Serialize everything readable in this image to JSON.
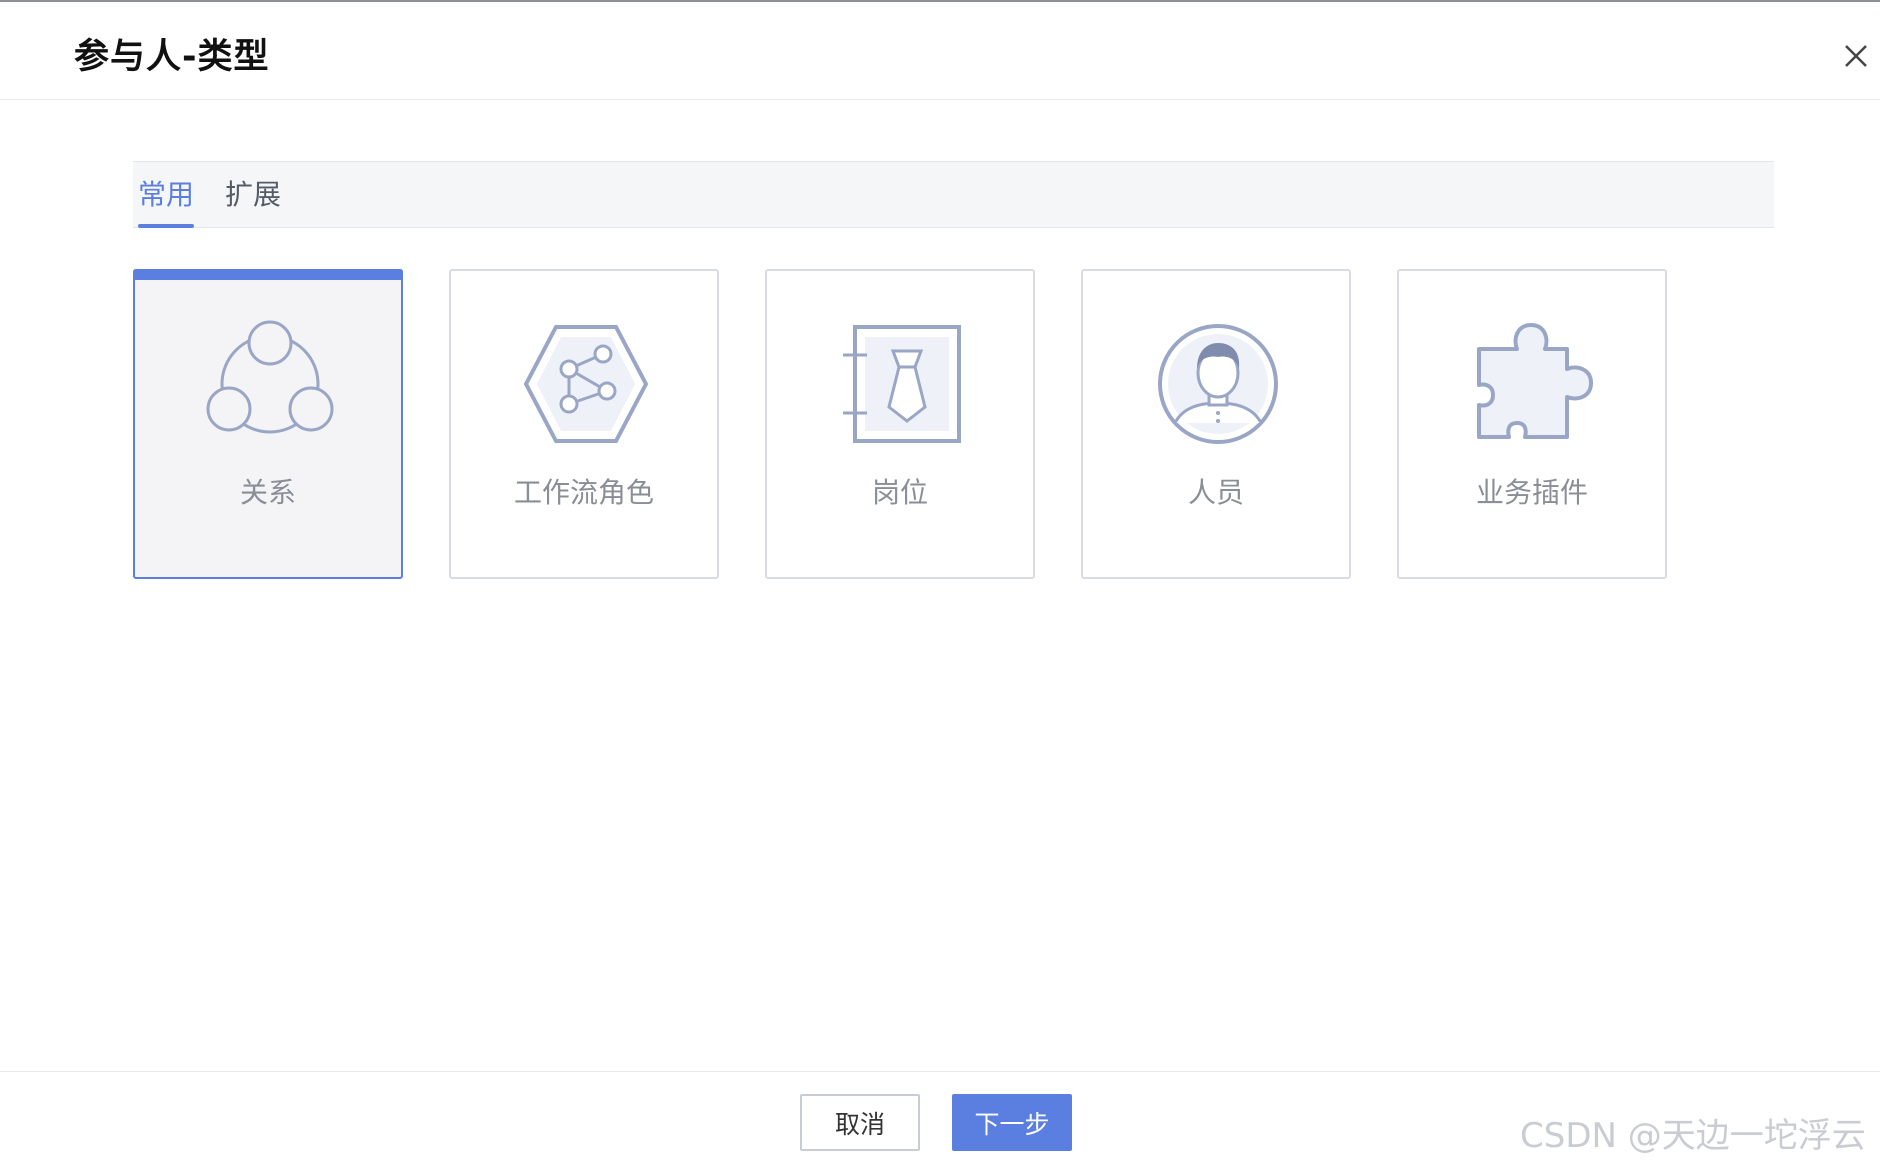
{
  "dialog": {
    "title": "参与人-类型"
  },
  "tabs": [
    {
      "label": "常用",
      "active": true
    },
    {
      "label": "扩展",
      "active": false
    }
  ],
  "cards": [
    {
      "label": "关系",
      "icon": "relationship-icon",
      "selected": true
    },
    {
      "label": "工作流角色",
      "icon": "workflow-role-icon",
      "selected": false
    },
    {
      "label": "岗位",
      "icon": "position-icon",
      "selected": false
    },
    {
      "label": "人员",
      "icon": "person-icon",
      "selected": false
    },
    {
      "label": "业务插件",
      "icon": "puzzle-plugin-icon",
      "selected": false
    }
  ],
  "footer": {
    "cancel_label": "取消",
    "next_label": "下一步"
  },
  "watermark": "CSDN @天边一坨浮云",
  "colors": {
    "accent": "#5b7fe0",
    "icon_stroke": "#9aa6c6",
    "card_border": "#d9dce3"
  }
}
